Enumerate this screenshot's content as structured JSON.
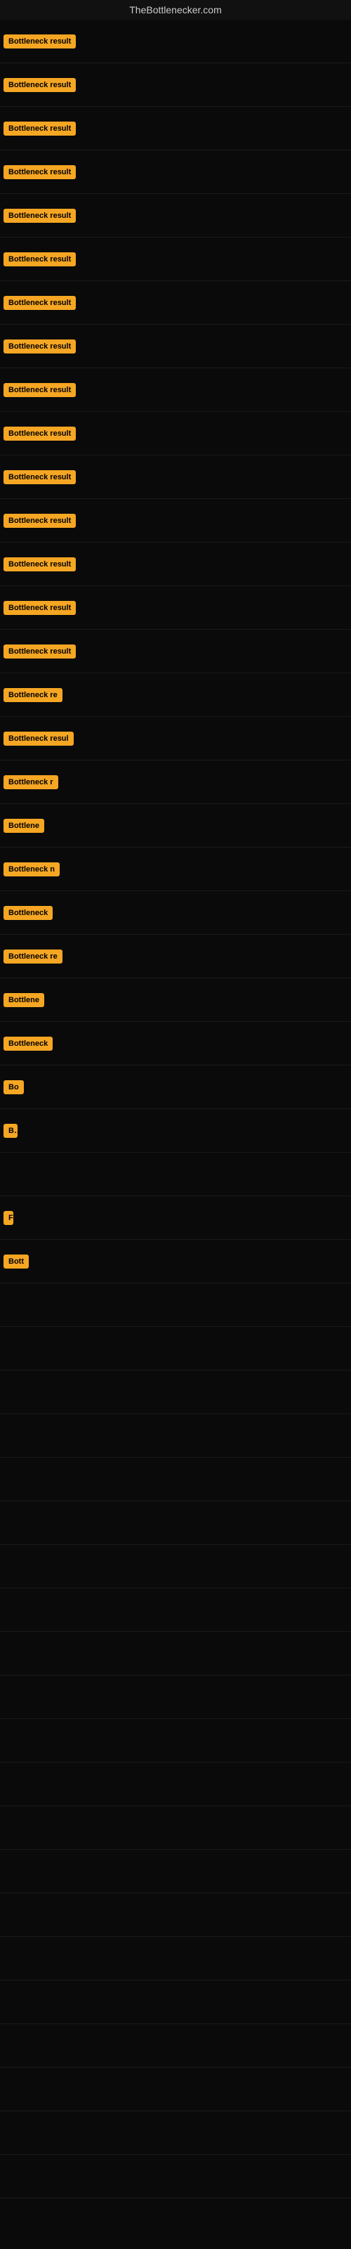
{
  "header": {
    "title": "TheBottlenecker.com"
  },
  "items": [
    {
      "label": "Bottleneck result",
      "max_width": 140
    },
    {
      "label": "Bottleneck result",
      "max_width": 140
    },
    {
      "label": "Bottleneck result",
      "max_width": 140
    },
    {
      "label": "Bottleneck result",
      "max_width": 140
    },
    {
      "label": "Bottleneck result",
      "max_width": 140
    },
    {
      "label": "Bottleneck result",
      "max_width": 140
    },
    {
      "label": "Bottleneck result",
      "max_width": 140
    },
    {
      "label": "Bottleneck result",
      "max_width": 140
    },
    {
      "label": "Bottleneck result",
      "max_width": 140
    },
    {
      "label": "Bottleneck result",
      "max_width": 140
    },
    {
      "label": "Bottleneck result",
      "max_width": 140
    },
    {
      "label": "Bottleneck result",
      "max_width": 130
    },
    {
      "label": "Bottleneck result",
      "max_width": 125
    },
    {
      "label": "Bottleneck result",
      "max_width": 120
    },
    {
      "label": "Bottleneck result",
      "max_width": 115
    },
    {
      "label": "Bottleneck re",
      "max_width": 100
    },
    {
      "label": "Bottleneck resul",
      "max_width": 105
    },
    {
      "label": "Bottleneck r",
      "max_width": 92
    },
    {
      "label": "Bottlene",
      "max_width": 78
    },
    {
      "label": "Bottleneck n",
      "max_width": 95
    },
    {
      "label": "Bottleneck",
      "max_width": 85
    },
    {
      "label": "Bottleneck re",
      "max_width": 100
    },
    {
      "label": "Bottlene",
      "max_width": 76
    },
    {
      "label": "Bottleneck",
      "max_width": 83
    },
    {
      "label": "Bo",
      "max_width": 40
    },
    {
      "label": "B",
      "max_width": 20
    },
    {
      "label": "",
      "max_width": 0
    },
    {
      "label": "F",
      "max_width": 14
    },
    {
      "label": "Bott",
      "max_width": 48
    },
    {
      "label": "",
      "max_width": 0
    },
    {
      "label": "",
      "max_width": 0
    },
    {
      "label": "",
      "max_width": 0
    },
    {
      "label": "",
      "max_width": 0
    },
    {
      "label": "",
      "max_width": 0
    },
    {
      "label": "",
      "max_width": 0
    },
    {
      "label": "",
      "max_width": 0
    },
    {
      "label": "",
      "max_width": 0
    },
    {
      "label": "",
      "max_width": 0
    },
    {
      "label": "",
      "max_width": 0
    },
    {
      "label": "",
      "max_width": 0
    },
    {
      "label": "",
      "max_width": 0
    },
    {
      "label": "",
      "max_width": 0
    },
    {
      "label": "",
      "max_width": 0
    },
    {
      "label": "",
      "max_width": 0
    },
    {
      "label": "",
      "max_width": 0
    },
    {
      "label": "",
      "max_width": 0
    },
    {
      "label": "",
      "max_width": 0
    },
    {
      "label": "",
      "max_width": 0
    },
    {
      "label": "",
      "max_width": 0
    },
    {
      "label": "",
      "max_width": 0
    }
  ]
}
